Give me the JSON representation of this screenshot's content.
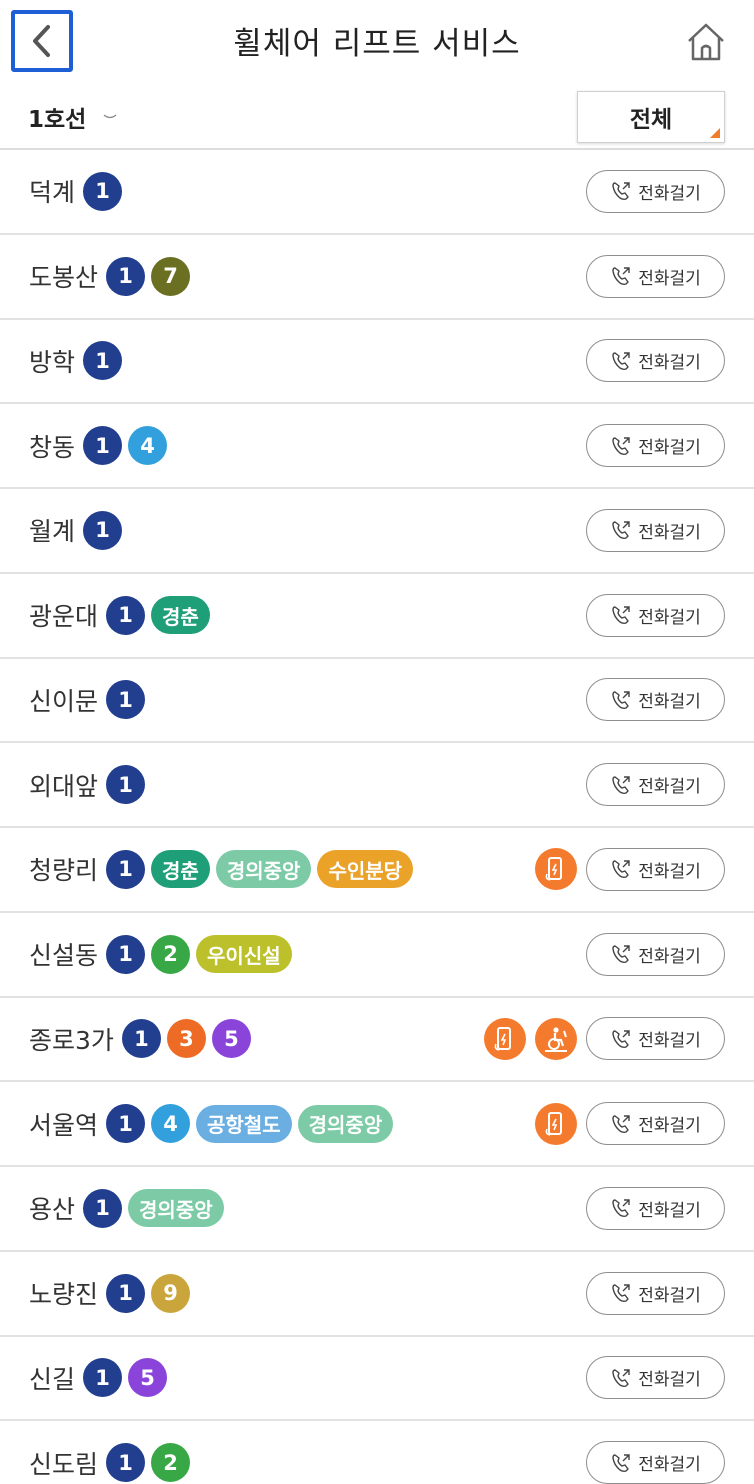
{
  "header": {
    "title": "휠체어 리프트 서비스"
  },
  "filter": {
    "line": "1호선",
    "scope": "전체"
  },
  "call_label": "전화걸기",
  "colors": {
    "1": "#223e8f",
    "2": "#38a847",
    "3": "#ee6b25",
    "4": "#31a0dc",
    "5": "#8a44d9",
    "7": "#6b6f22",
    "9": "#c9a53c",
    "경춘": "#1f9f77",
    "경의중앙": "#7ccba6",
    "수인분당": "#eaa229",
    "우이신설": "#bcc02a",
    "공항철도": "#6aaee2",
    "facility": "#f47a2d"
  },
  "stations": [
    {
      "name": "덕계",
      "lines": [
        "1"
      ],
      "facilities": []
    },
    {
      "name": "도봉산",
      "lines": [
        "1",
        "7"
      ],
      "facilities": []
    },
    {
      "name": "방학",
      "lines": [
        "1"
      ],
      "facilities": []
    },
    {
      "name": "창동",
      "lines": [
        "1",
        "4"
      ],
      "facilities": []
    },
    {
      "name": "월계",
      "lines": [
        "1"
      ],
      "facilities": []
    },
    {
      "name": "광운대",
      "lines": [
        "1",
        "경춘"
      ],
      "facilities": []
    },
    {
      "name": "신이문",
      "lines": [
        "1"
      ],
      "facilities": []
    },
    {
      "name": "외대앞",
      "lines": [
        "1"
      ],
      "facilities": []
    },
    {
      "name": "청량리",
      "lines": [
        "1",
        "경춘",
        "경의중앙",
        "수인분당"
      ],
      "facilities": [
        "phone-charger-icon"
      ]
    },
    {
      "name": "신설동",
      "lines": [
        "1",
        "2",
        "우이신설"
      ],
      "facilities": []
    },
    {
      "name": "종로3가",
      "lines": [
        "1",
        "3",
        "5"
      ],
      "facilities": [
        "phone-charger-icon",
        "wheelchair-lift-icon"
      ]
    },
    {
      "name": "서울역",
      "lines": [
        "1",
        "4",
        "공항철도",
        "경의중앙"
      ],
      "facilities": [
        "phone-charger-icon"
      ]
    },
    {
      "name": "용산",
      "lines": [
        "1",
        "경의중앙"
      ],
      "facilities": []
    },
    {
      "name": "노량진",
      "lines": [
        "1",
        "9"
      ],
      "facilities": []
    },
    {
      "name": "신길",
      "lines": [
        "1",
        "5"
      ],
      "facilities": []
    },
    {
      "name": "신도림",
      "lines": [
        "1",
        "2"
      ],
      "facilities": []
    }
  ]
}
